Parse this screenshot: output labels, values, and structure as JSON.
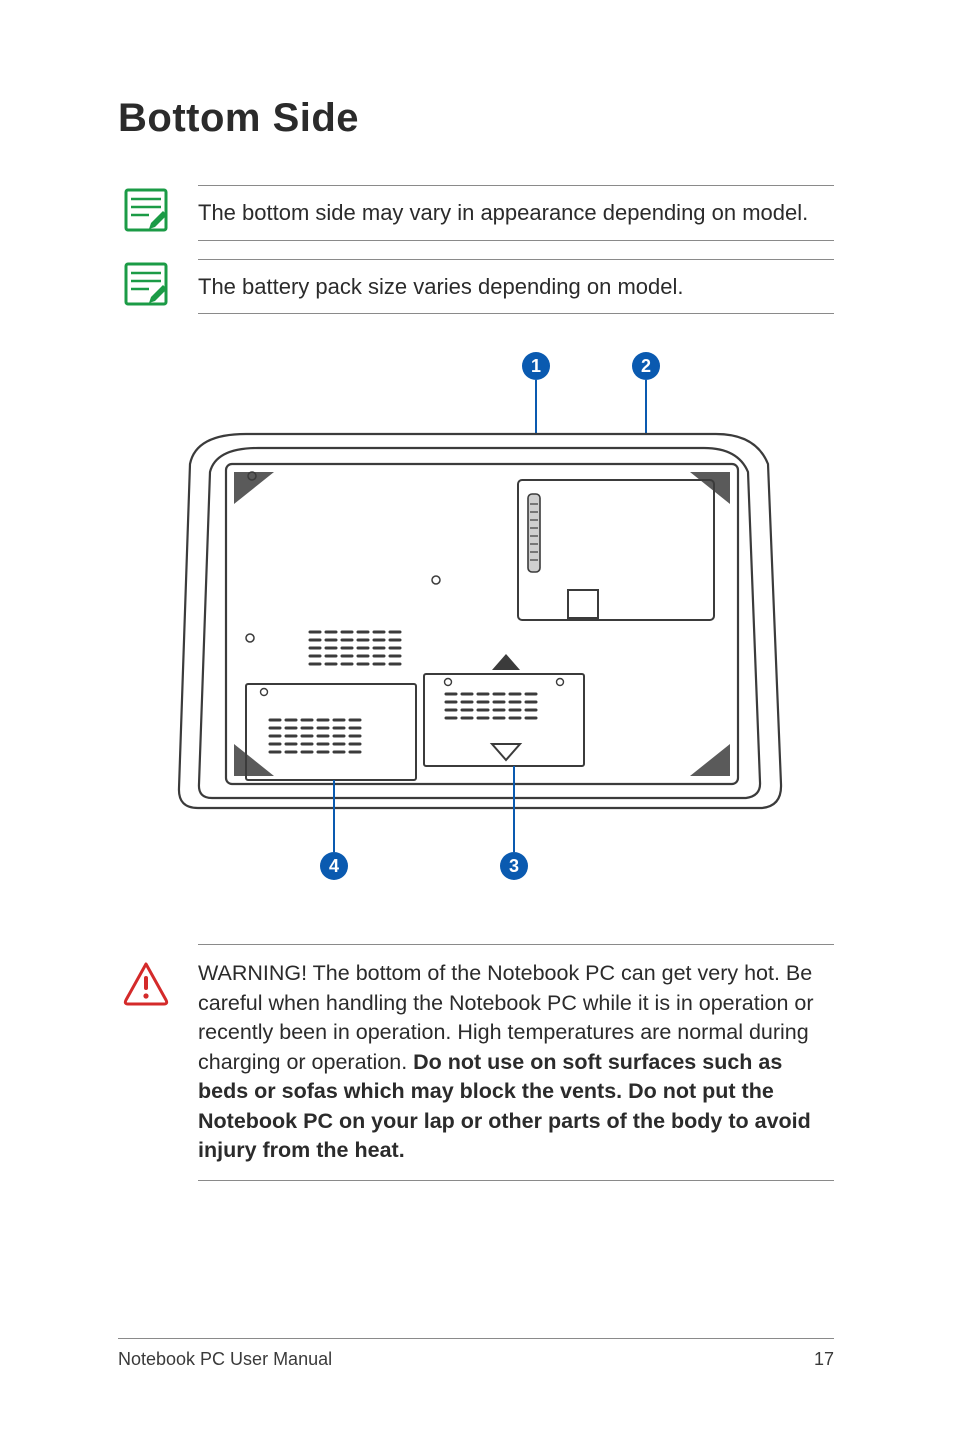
{
  "title": "Bottom Side",
  "notes": {
    "note1": "The bottom side may vary in appearance depending on model.",
    "note2": "The battery pack size varies depending on model."
  },
  "callouts": {
    "c1": "1",
    "c2": "2",
    "c3": "3",
    "c4": "4"
  },
  "warning": {
    "lead": "WARNING!  The bottom of the Notebook PC can get very hot. Be careful when handling the Notebook PC while it is in operation or recently been in operation. High temperatures are normal during charging or operation. ",
    "bold": "Do not use on soft surfaces such as beds or sofas which may block the vents. Do not put the Notebook PC on your lap or other parts of the body to avoid injury from the heat."
  },
  "footer": {
    "left": "Notebook PC User Manual",
    "page": "17"
  }
}
